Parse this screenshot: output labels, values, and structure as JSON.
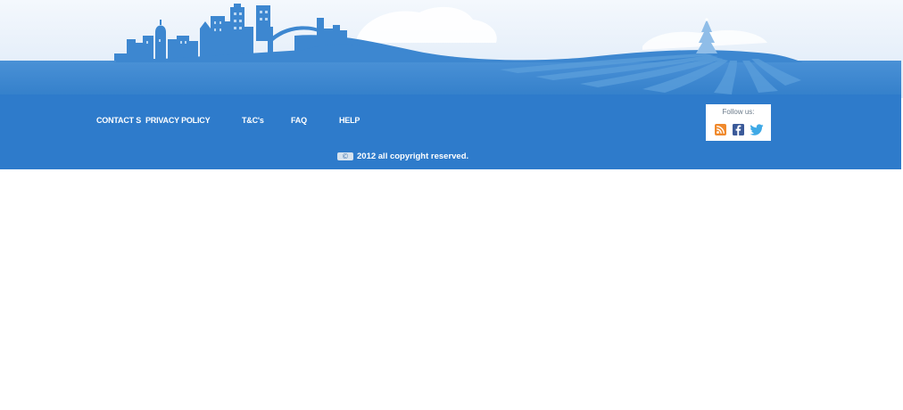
{
  "footer": {
    "links": [
      {
        "label": "CONTACT S",
        "name": "footer-link-contact"
      },
      {
        "label": "PRIVACY POLICY",
        "name": "footer-link-privacy-policy"
      },
      {
        "label": "T&C's",
        "name": "footer-link-terms"
      },
      {
        "label": "FAQ",
        "name": "footer-link-faq"
      },
      {
        "label": "HELP",
        "name": "footer-link-help"
      }
    ],
    "follow": {
      "label": "Follow us:",
      "icons": [
        "rss-icon",
        "facebook-icon",
        "twitter-icon"
      ]
    },
    "copyright": {
      "icon": "copyright-icon",
      "text": "2012 all copyright reserved."
    }
  },
  "colors": {
    "footer_bar": "#2e7bcb",
    "sea": "#3b86cf",
    "sky": "#e9f2fb",
    "skyline": "#3d87d0",
    "rss": "#f0892c",
    "facebook": "#3b5a99",
    "twitter": "#3fa9e6"
  }
}
